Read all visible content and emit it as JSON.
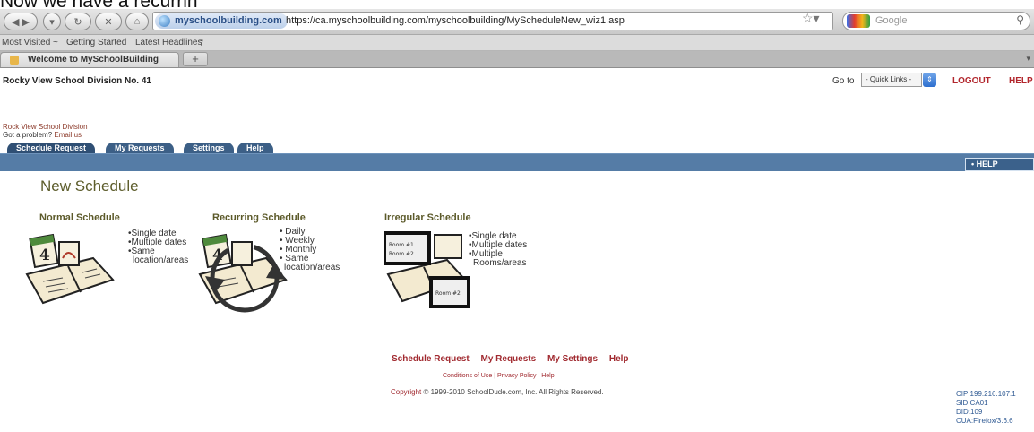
{
  "caption": "Now we have a recurrin",
  "browser": {
    "site_identity": "myschoolbuilding.com",
    "url": "https://ca.myschoolbuilding.com/myschoolbuilding/MyScheduleNew_wiz1.asp",
    "search_engine": "Google",
    "search_placeholder": "Google",
    "bookmarks": [
      "Most Visited ~",
      "Getting Started",
      "Latest Headlines"
    ],
    "tab_title": "Welcome to MySchoolBuilding",
    "new_tab": "+"
  },
  "header": {
    "org": "Rocky View School Division No. 41",
    "goto_label": "Go to",
    "quick_links": "- Quick Links -",
    "logout": "LOGOUT",
    "help": "HELP",
    "division": "Rock View School Division",
    "problem_prefix": "Got a problem?",
    "problem_link": "Email us"
  },
  "app_tabs": [
    "Schedule Request",
    "My Requests",
    "Settings",
    "Help"
  ],
  "help_button": "• HELP",
  "page_title": "New Schedule",
  "schedules": [
    {
      "title": "Normal Schedule",
      "options": [
        "•Single date",
        "•Multiple dates",
        "•Same",
        "location/areas"
      ]
    },
    {
      "title": "Recurring Schedule",
      "options": [
        "• Daily",
        "• Weekly",
        "• Monthly",
        "• Same",
        "location/areas"
      ]
    },
    {
      "title": "Irregular Schedule",
      "options": [
        "•Single date",
        "•Multiple dates",
        "•Multiple",
        "Rooms/areas"
      ]
    }
  ],
  "illustrations": {
    "calendar_day": "4",
    "room_labels": [
      "Room #1",
      "Room #2",
      "Room #2"
    ]
  },
  "footer": {
    "nav": [
      "Schedule Request",
      "My Requests",
      "My Settings",
      "Help"
    ],
    "links": "Conditions of Use | Privacy Policy | Help",
    "copyright_prefix": "Copyright",
    "copyright_text": "© 1999-2010 SchoolDude.com, Inc. All Rights Reserved."
  },
  "diagnostics": [
    "CIP:199.216.107.1",
    "SID:CA01",
    "DID:109",
    "CUA:Firefox/3.6.6"
  ],
  "colors": {
    "nav_bar": "#557ca6",
    "tab": "#3c5f86",
    "accent_red": "#b2272d",
    "title_olive": "#5d5d2c"
  }
}
